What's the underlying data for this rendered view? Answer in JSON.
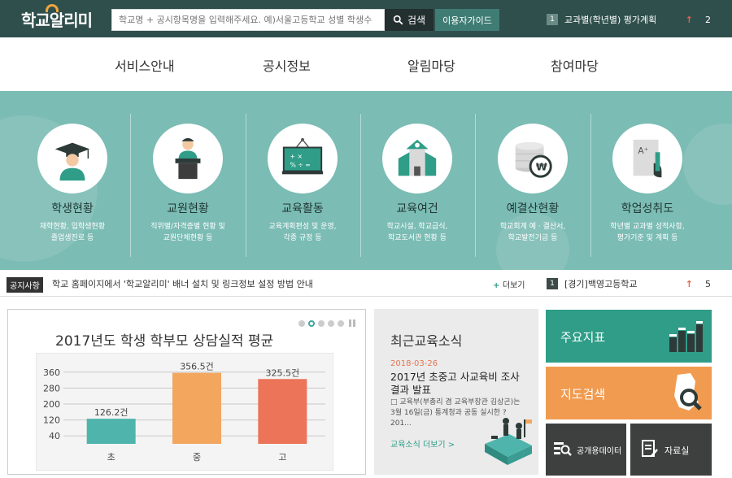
{
  "header": {
    "logo": "학교알리미",
    "search_placeholder": "학교명 + 공시항목명을 입력해주세요. 예)서울고등학교 성별 학생수",
    "search_button": "검색",
    "guide_button": "이용자가이드",
    "top_rank": {
      "num": "1",
      "label": "교과별(학년별) 평가계획",
      "change": "2"
    }
  },
  "nav": {
    "items": [
      "서비스안내",
      "공시정보",
      "알림마당",
      "참여마당"
    ]
  },
  "categories": [
    {
      "title": "학생현황",
      "desc1": "재학현황, 입학생현황",
      "desc2": "졸업생진로 등",
      "icon": "student-graduation-icon"
    },
    {
      "title": "교원현황",
      "desc1": "직위별/자격증별 현황 및",
      "desc2": "교원단체현황 등",
      "icon": "teacher-podium-icon"
    },
    {
      "title": "교육활동",
      "desc1": "교육계획편성 및 운영,",
      "desc2": "각종 규정 등",
      "icon": "blackboard-icon"
    },
    {
      "title": "교육여건",
      "desc1": "학교시설, 학교급식,",
      "desc2": "학교도서관 현황 등",
      "icon": "school-building-icon"
    },
    {
      "title": "예결산현황",
      "desc1": "학교회계 예 · 결산서,",
      "desc2": "학교발전기금 등",
      "icon": "coins-won-icon"
    },
    {
      "title": "학업성취도",
      "desc1": "학년별 교과별 성적사항,",
      "desc2": "평가기준 및 계획 등",
      "icon": "grade-paper-icon"
    }
  ],
  "notice": {
    "badge": "공지사항",
    "text": "학교 홈페이지에서 '학교알리미' 배너 설치 및 링크정보 설정 방법 안내",
    "more": "더보기",
    "rank": {
      "num": "1",
      "label": "[경기]백영고등학교",
      "change": "5"
    }
  },
  "chart_data": {
    "type": "bar",
    "title": "2017년도 학생 학부모 상담실적 평균",
    "categories": [
      "초",
      "중",
      "고"
    ],
    "values": [
      126.2,
      356.5,
      325.5
    ],
    "value_labels": [
      "126.2건",
      "356.5건",
      "325.5건"
    ],
    "yticks": [
      40,
      120,
      200,
      280,
      360
    ],
    "ylim": [
      0,
      400
    ],
    "colors": [
      "#4fb5ac",
      "#f3a65e",
      "#ec7459"
    ],
    "grid": true
  },
  "news": {
    "title": "최근교육소식",
    "date": "2018-03-26",
    "headline": "2017년 초중고 사교육비 조사 결과 발표",
    "body": "□ 교육부(부총리 겸 교육부장관 김상곤)는 3월 16일(금) 통계청과 공동 실시한 ?201...",
    "more": "교육소식 더보기 >"
  },
  "tiles": {
    "key_indicators": "주요지표",
    "map_search": "지도검색",
    "open_data": "공개용데이터",
    "library": "자료실"
  },
  "colors": {
    "topbar": "#2f4f4c",
    "hero": "#7bbcb4",
    "accent_green": "#2f9d87",
    "accent_orange": "#f19b50"
  }
}
